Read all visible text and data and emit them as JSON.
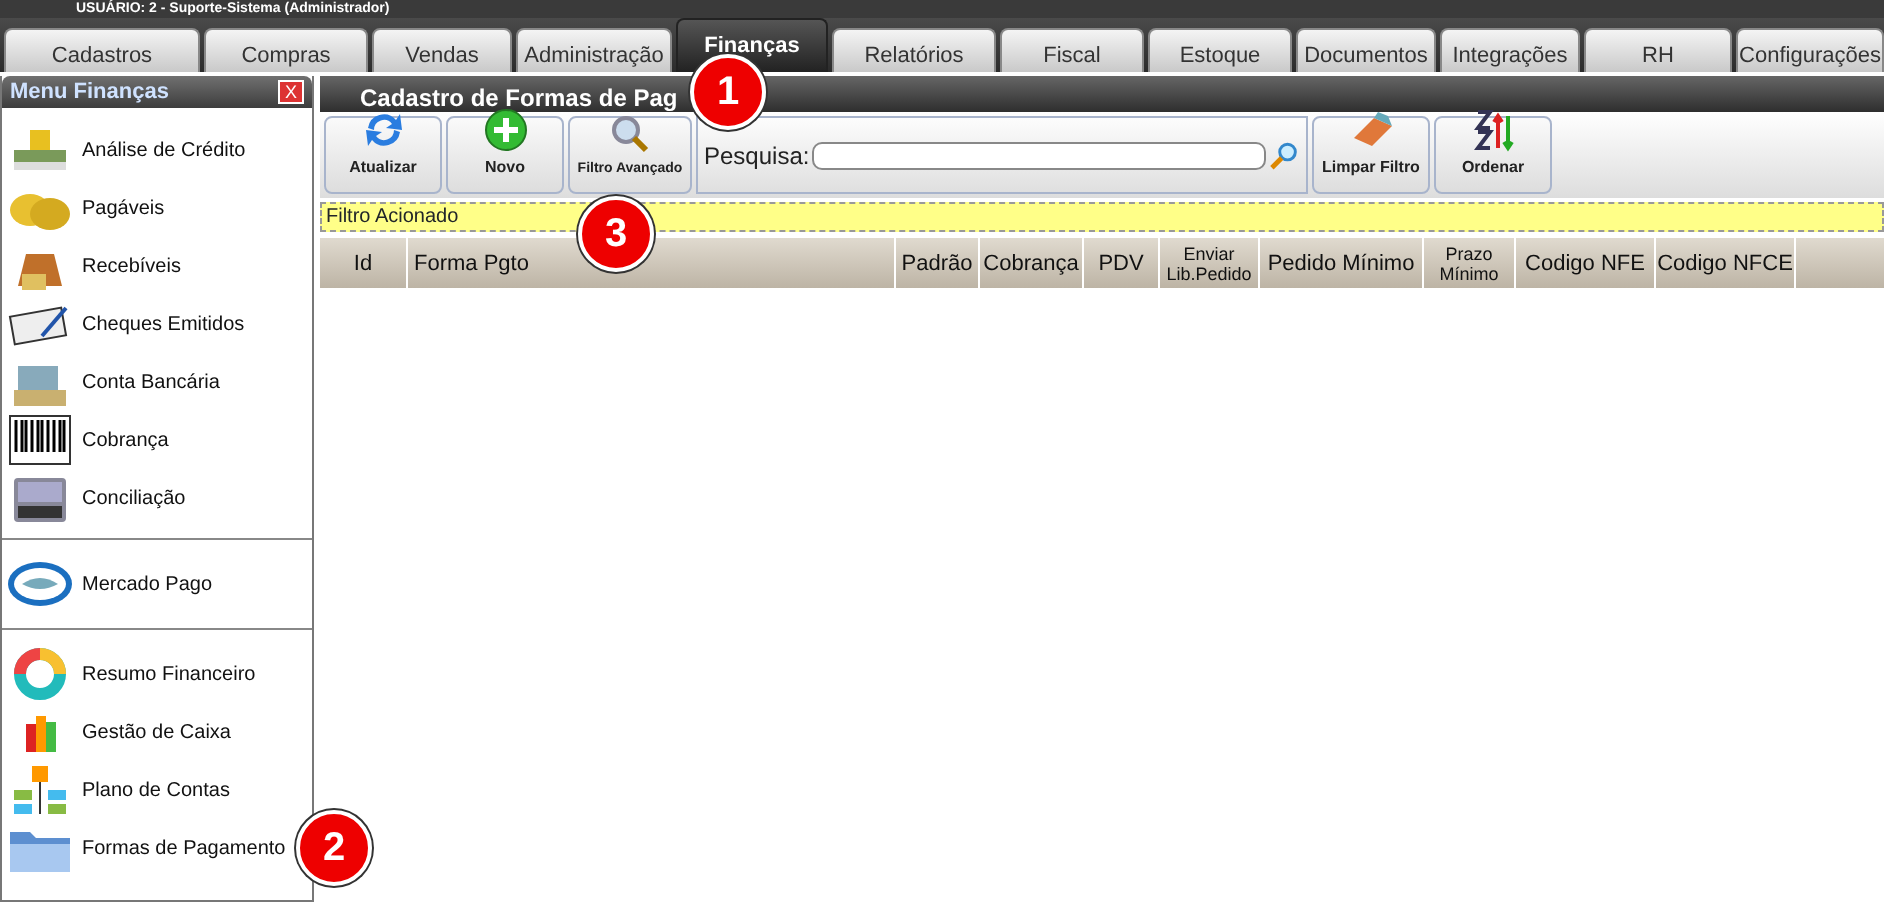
{
  "user_bar": {
    "text": "USUÁRIO:  2 - Suporte-Sistema (Administrador)"
  },
  "tabs": [
    {
      "label": "Cadastros",
      "selected": false
    },
    {
      "label": "Compras",
      "selected": false
    },
    {
      "label": "Vendas",
      "selected": false
    },
    {
      "label": "Administração",
      "selected": false
    },
    {
      "label": "Finanças",
      "selected": true
    },
    {
      "label": "Relatórios",
      "selected": false
    },
    {
      "label": "Fiscal",
      "selected": false
    },
    {
      "label": "Estoque",
      "selected": false
    },
    {
      "label": "Documentos",
      "selected": false
    },
    {
      "label": "Integrações",
      "selected": false
    },
    {
      "label": "RH",
      "selected": false
    },
    {
      "label": "Configurações",
      "selected": false
    }
  ],
  "sidebar": {
    "title": "Menu Finanças",
    "close": "X",
    "groups": [
      {
        "items": [
          "Análise de Crédito",
          "Pagáveis",
          "Recebíveis",
          "Cheques Emitidos",
          "Conta Bancária",
          "Cobrança",
          "Conciliação"
        ]
      },
      {
        "items": [
          "Mercado Pago"
        ]
      },
      {
        "items": [
          "Resumo Financeiro",
          "Gestão de Caixa",
          "Plano de Contas",
          "Formas de Pagamento"
        ]
      }
    ]
  },
  "main": {
    "title": "Cadastro de Formas de Pag",
    "toolbar": [
      {
        "kind": "button",
        "label": "Atualizar"
      },
      {
        "kind": "button",
        "label": "Novo"
      },
      {
        "kind": "button",
        "label": "Filtro Avançado"
      },
      {
        "kind": "search",
        "label": "Pesquisa:"
      },
      {
        "kind": "button",
        "label": "Limpar Filtro"
      },
      {
        "kind": "button",
        "label": "Ordenar"
      }
    ],
    "filter_status": "Filtro Acionado",
    "table": {
      "columns": [
        "Id",
        "Forma Pgto",
        "Padrão",
        "Cobrança",
        "PDV",
        "Enviar Lib.Pedido",
        "Pedido Mínimo",
        "Prazo Mínimo",
        "Codigo NFE",
        "Codigo NFCE"
      ]
    }
  },
  "markers": [
    "1",
    "2",
    "3"
  ]
}
